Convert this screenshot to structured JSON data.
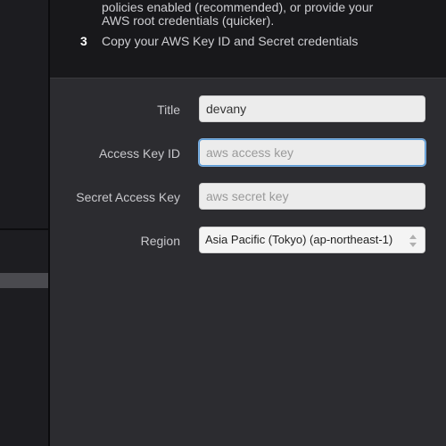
{
  "instructions": {
    "partial_line_1": "policies enabled (recommended), or provide your",
    "partial_line_2": "AWS root credentials (quicker).",
    "step3_number": "3",
    "step3_text": "Copy your AWS Key ID and Secret credentials"
  },
  "form": {
    "title": {
      "label": "Title",
      "value": "devany"
    },
    "access_key": {
      "label": "Access Key ID",
      "placeholder": "aws access key"
    },
    "secret_key": {
      "label": "Secret Access Key",
      "placeholder": "aws secret key"
    },
    "region": {
      "label": "Region",
      "value": "Asia Pacific (Tokyo) (ap-northeast-1)"
    }
  }
}
